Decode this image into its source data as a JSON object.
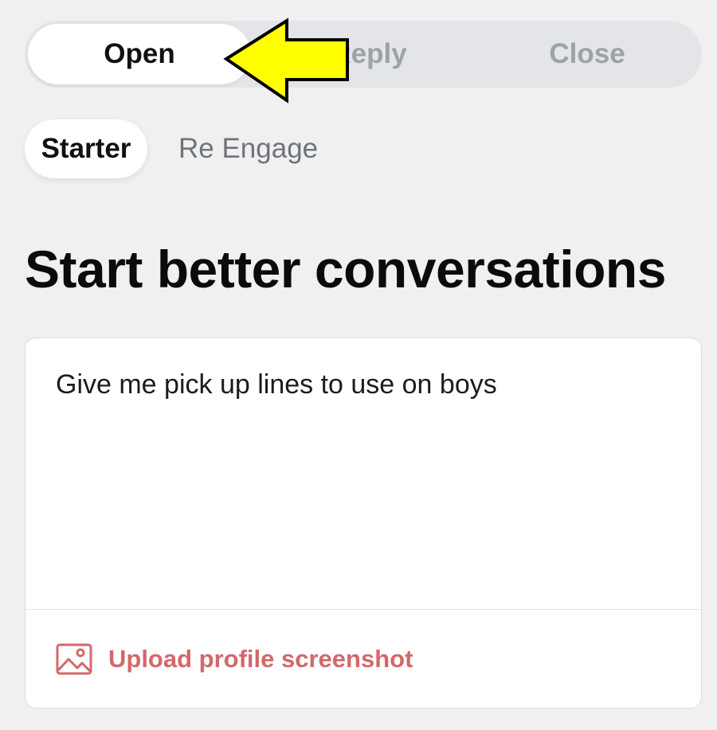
{
  "mode_tabs": {
    "open_label": "Open",
    "reply_label": "Reply",
    "close_label": "Close",
    "selected": "Open"
  },
  "sub_tabs": {
    "starter_label": "Starter",
    "reengage_label": "Re Engage",
    "selected": "Starter"
  },
  "main": {
    "title": "Start better conversations"
  },
  "composer": {
    "prompt_text": "Give me pick up lines to use on boys",
    "upload_label": "Upload profile screenshot",
    "upload_icon": "image-icon"
  },
  "annotation": {
    "arrow_icon": "yellow-arrow-pointer-icon",
    "arrow_color": "#ffff00"
  },
  "colors": {
    "accent": "#d3686a",
    "inactive_text": "#9da1a8",
    "background": "#f0f0f0"
  }
}
